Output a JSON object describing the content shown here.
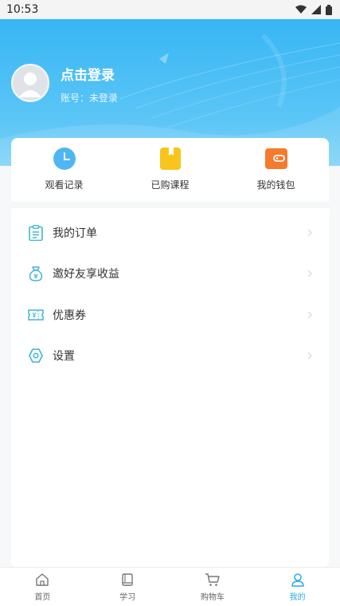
{
  "status_bar": {
    "time": "10:53"
  },
  "profile": {
    "title": "点击登录",
    "account": "账号：未登录"
  },
  "quick_actions": [
    {
      "label": "观看记录",
      "icon": "clock-icon",
      "color": "#4fb6f2"
    },
    {
      "label": "已购课程",
      "icon": "bookmark-icon",
      "color": "#f8c51c"
    },
    {
      "label": "我的钱包",
      "icon": "wallet-icon",
      "color": "#f57a2c"
    }
  ],
  "menu": [
    {
      "label": "我的订单",
      "icon": "clipboard-icon"
    },
    {
      "label": "邀好友享收益",
      "icon": "money-bag-icon"
    },
    {
      "label": "优惠券",
      "icon": "coupon-icon"
    },
    {
      "label": "设置",
      "icon": "gear-icon"
    }
  ],
  "bottom_nav": [
    {
      "label": "首页",
      "icon": "home-icon",
      "active": false
    },
    {
      "label": "学习",
      "icon": "book-icon",
      "active": false
    },
    {
      "label": "购物车",
      "icon": "cart-icon",
      "active": false
    },
    {
      "label": "我的",
      "icon": "person-icon",
      "active": true
    }
  ],
  "colors": {
    "header_blue": "#38b6f4",
    "accent": "#27a9ee",
    "icon_teal": "#3fb5d4"
  }
}
